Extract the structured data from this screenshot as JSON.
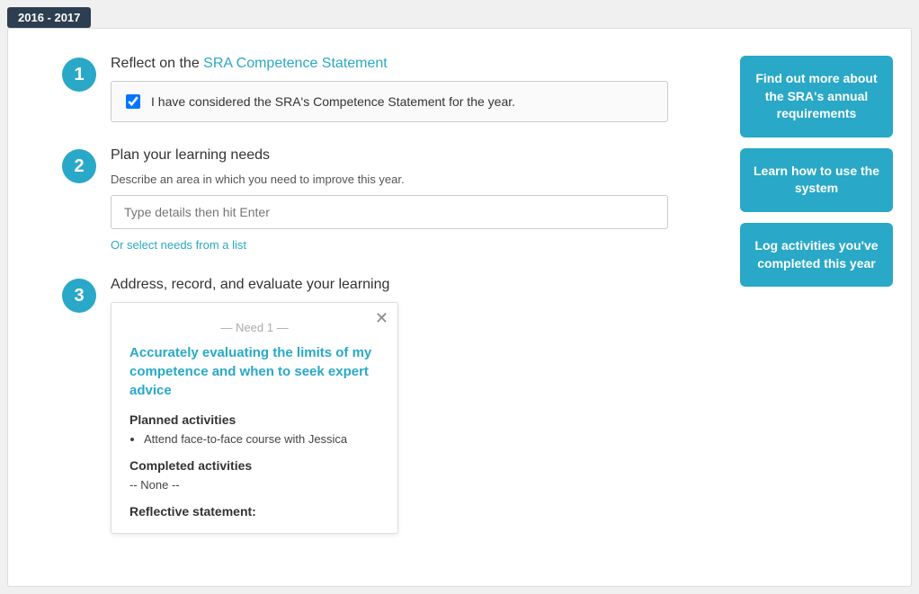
{
  "year_badge": "2016 - 2017",
  "steps": [
    {
      "number": "1",
      "title_prefix": "Reflect on the ",
      "title_link": "SRA Competence Statement",
      "checkbox_label": "I have considered the SRA's Competence Statement for the year."
    },
    {
      "number": "2",
      "title": "Plan your learning needs",
      "subtitle": "Describe an area in which you need to improve this year.",
      "input_placeholder": "Type details then hit Enter",
      "or_select_text": "Or select needs from a list"
    },
    {
      "number": "3",
      "title": "Address, record, and evaluate your learning",
      "need_popup": {
        "need_label": "— Need 1 —",
        "need_title": "Accurately evaluating the limits of my competence and when to seek expert advice",
        "planned_activities_title": "Planned activities",
        "planned_activities": [
          "Attend face-to-face course with Jessica"
        ],
        "completed_activities_title": "Completed activities",
        "completed_activities_none": "-- None --",
        "reflective_statement_title": "Reflective statement:"
      }
    }
  ],
  "sidebar_buttons": [
    {
      "label": "Find out more about the SRA's annual requirements"
    },
    {
      "label": "Learn how to use the system"
    },
    {
      "label": "Log activities you've completed this year"
    }
  ]
}
